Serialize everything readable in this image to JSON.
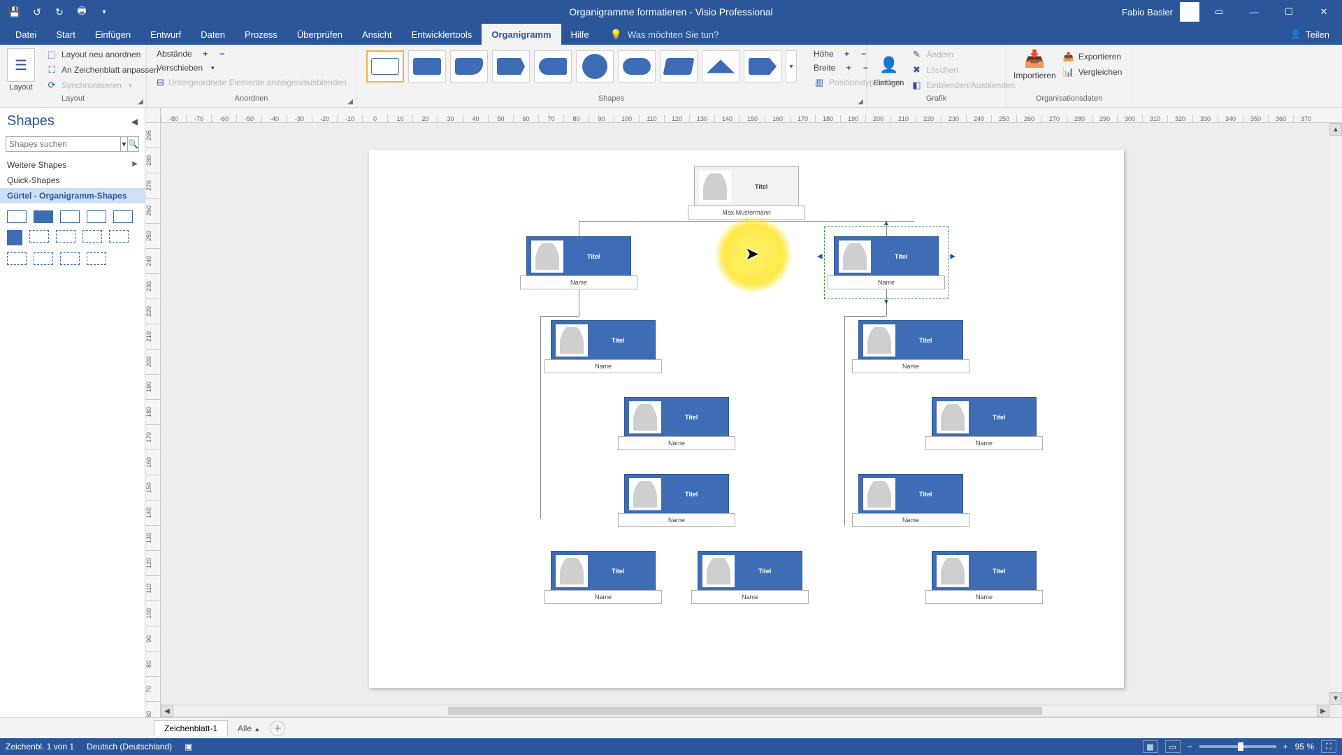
{
  "titlebar": {
    "doc_title": "Organigramme formatieren  -  Visio Professional",
    "user": "Fabio Basler"
  },
  "tabs": {
    "datei": "Datei",
    "start": "Start",
    "einfugen": "Einfügen",
    "entwurf": "Entwurf",
    "daten": "Daten",
    "prozess": "Prozess",
    "uberprufen": "Überprüfen",
    "ansicht": "Ansicht",
    "entwicklertools": "Entwicklertools",
    "organigramm": "Organigramm",
    "hilfe": "Hilfe",
    "tellme": "Was möchten Sie tun?",
    "teilen": "Teilen"
  },
  "ribbon": {
    "layout": {
      "label": "Layout",
      "group_label": "Layout",
      "neu": "Layout neu anordnen",
      "zeichenblatt": "An Zeichenblatt anpassen",
      "sync": "Synchronisieren"
    },
    "anordnen": {
      "group_label": "Anordnen",
      "abstande": "Abstände",
      "verschieben": "Verschieben",
      "untergeordnete": "Untergeordnete Elemente anzeigen/ausblenden"
    },
    "shapes": {
      "group_label": "Shapes",
      "hohe": "Höhe",
      "breite": "Breite",
      "positionstyp": "Positionstyp ändern"
    },
    "grafik": {
      "group_label": "Grafik",
      "einfugen": "Einfügen",
      "andern": "Ändern",
      "loschen": "Löschen",
      "einblenden": "Einblenden/Ausblenden"
    },
    "orgdaten": {
      "group_label": "Organisationsdaten",
      "importieren": "Importieren",
      "exportieren": "Exportieren",
      "vergleichen": "Vergleichen"
    }
  },
  "shapes_panel": {
    "title": "Shapes",
    "search_placeholder": "Shapes suchen",
    "weitere": "Weitere Shapes",
    "quick": "Quick-Shapes",
    "gurtel": "Gürtel - Organigramm-Shapes"
  },
  "ruler_h": [
    "-80",
    "-70",
    "-60",
    "-50",
    "-40",
    "-30",
    "-20",
    "-10",
    "0",
    "10",
    "20",
    "30",
    "40",
    "50",
    "60",
    "70",
    "80",
    "90",
    "100",
    "110",
    "120",
    "130",
    "140",
    "150",
    "160",
    "170",
    "180",
    "190",
    "200",
    "210",
    "220",
    "230",
    "240",
    "250",
    "260",
    "270",
    "280",
    "290",
    "300",
    "310",
    "320",
    "330",
    "340",
    "350",
    "360",
    "370"
  ],
  "ruler_v": [
    "295",
    "280",
    "270",
    "260",
    "250",
    "240",
    "230",
    "220",
    "210",
    "200",
    "190",
    "180",
    "170",
    "160",
    "150",
    "140",
    "130",
    "120",
    "110",
    "100",
    "90",
    "80",
    "70",
    "60"
  ],
  "org": {
    "root": {
      "title": "Titel",
      "name": "Max Mustermann"
    },
    "l2a": {
      "title": "Titel",
      "name": "Name"
    },
    "l2b": {
      "title": "Titel",
      "name": "Name"
    },
    "lA3": {
      "title": "Titel",
      "name": "Name"
    },
    "lA4": {
      "title": "Titel",
      "name": "Name"
    },
    "lA5": {
      "title": "Titel",
      "name": "Name"
    },
    "lA6a": {
      "title": "Titel",
      "name": "Name"
    },
    "lA6b": {
      "title": "Titel",
      "name": "Name"
    },
    "lB3": {
      "title": "Titel",
      "name": "Name"
    },
    "lB4": {
      "title": "Titel",
      "name": "Name"
    },
    "lB5": {
      "title": "Titel",
      "name": "Name"
    },
    "lB6": {
      "title": "Titel",
      "name": "Name"
    }
  },
  "sheet_tabs": {
    "sheet1": "Zeichenblatt-1",
    "alle": "Alle"
  },
  "status": {
    "page_info": "Zeichenbl. 1 von 1",
    "lang": "Deutsch (Deutschland)",
    "zoom": "95 %"
  }
}
